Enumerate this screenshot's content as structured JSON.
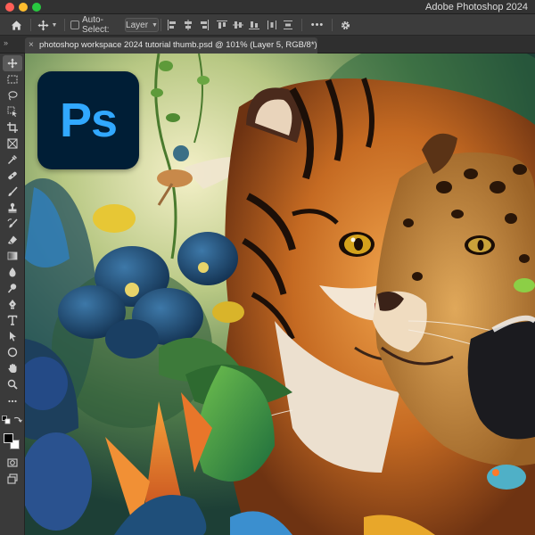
{
  "window": {
    "app_title": "Adobe Photoshop 2024"
  },
  "options_bar": {
    "auto_select_label": "Auto-Select:",
    "auto_select_checked": false,
    "auto_select_target": "Layer",
    "more_label": "•••"
  },
  "document": {
    "tab_title": "photoshop workspace 2024 tutorial thumb.psd @ 101% (Layer 5, RGB/8*) *",
    "close_glyph": "×",
    "panel_collapse": "»"
  },
  "canvas": {
    "logo_text": "Ps",
    "logo_colors": {
      "background": "#001e36",
      "text": "#31a8ff"
    }
  },
  "toolbar": {
    "tools": [
      "move-tool",
      "marquee-tool",
      "lasso-tool",
      "object-select-tool",
      "crop-tool",
      "frame-tool",
      "eyedropper-tool",
      "spot-healing-tool",
      "brush-tool",
      "clone-stamp-tool",
      "history-brush-tool",
      "eraser-tool",
      "gradient-tool",
      "blur-tool",
      "dodge-tool",
      "pen-tool",
      "type-tool",
      "path-select-tool",
      "ellipse-tool",
      "hand-tool",
      "zoom-tool",
      "edit-toolbar",
      "foreground-color",
      "background-color",
      "quick-mask",
      "screen-mode"
    ],
    "active_tool": "move-tool"
  },
  "colors": {
    "titlebar": "#323232",
    "optionsbar": "#3c3c3c",
    "toolbar": "#3a3a3a",
    "accent": "#31a8ff",
    "close": "#ff5f57",
    "minimize": "#febc2e",
    "maximize": "#28c840"
  }
}
